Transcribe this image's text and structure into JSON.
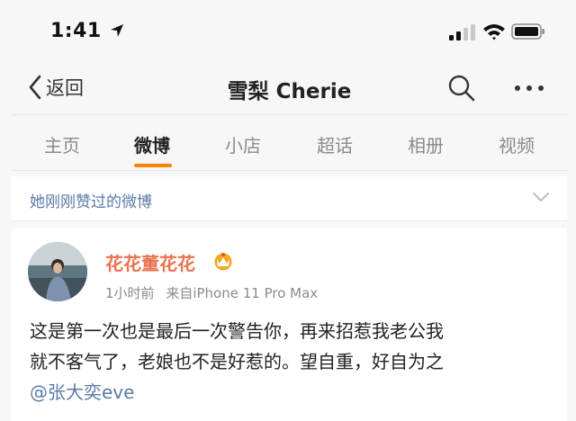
{
  "status_bar": {
    "time": "1:41",
    "icons": [
      "location-arrow-icon",
      "signal-icon",
      "wifi-icon",
      "battery-icon"
    ]
  },
  "nav": {
    "back_label": "返回",
    "title": "雪梨 Cherie",
    "icons": [
      "back-chevron-icon",
      "search-icon",
      "more-icon"
    ]
  },
  "tabs": [
    {
      "label": "主页",
      "active": false
    },
    {
      "label": "微博",
      "active": true
    },
    {
      "label": "小店",
      "active": false
    },
    {
      "label": "超话",
      "active": false
    },
    {
      "label": "相册",
      "active": false
    },
    {
      "label": "视频",
      "active": false
    }
  ],
  "liked_section": {
    "label": "她刚刚赞过的微博",
    "icon": "chevron-down-icon"
  },
  "post": {
    "username": "花花董花花",
    "badge_icon": "vip-crown-icon",
    "time": "1小时前",
    "source": "来自iPhone 11 Pro Max",
    "text_line1": "这是第一次也是最后一次警告你，再来招惹我老公我",
    "text_line2": "就不客气了，老娘也不是好惹的。望自重，好自为之",
    "mention": "@张大奕eve"
  },
  "colors": {
    "accent_orange": "#ff8200",
    "username": "#eb7350",
    "link_blue": "#5a7aa6",
    "muted": "#8a8a8a"
  }
}
